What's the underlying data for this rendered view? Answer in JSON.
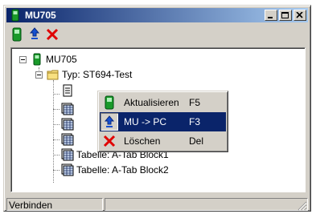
{
  "window": {
    "title": "MU705",
    "buttons": {
      "minimize": "minimize-icon",
      "maximize": "maximize-icon",
      "close": "close-icon"
    }
  },
  "toolbar": {
    "items": [
      "connect-icon",
      "upload-icon",
      "delete-icon"
    ]
  },
  "tree": {
    "root": "MU705",
    "folder": "Typ: ST694-Test",
    "children": [
      "Tabelle: A-Tab Block1",
      "Tabelle: A-Tab Block2"
    ]
  },
  "context_menu": {
    "items": [
      {
        "label": "Aktualisieren",
        "shortcut": "F5"
      },
      {
        "label": "MU -> PC",
        "shortcut": "F3"
      },
      {
        "label": "Löschen",
        "shortcut": "Del"
      }
    ]
  },
  "statusbar": {
    "text": "Verbinden"
  },
  "colors": {
    "title_start": "#0a246a",
    "title_end": "#a6caf0",
    "face": "#d4d0c8",
    "highlight": "#0a246a",
    "device_green": "#1a9a2a",
    "delete_red": "#e00000"
  }
}
